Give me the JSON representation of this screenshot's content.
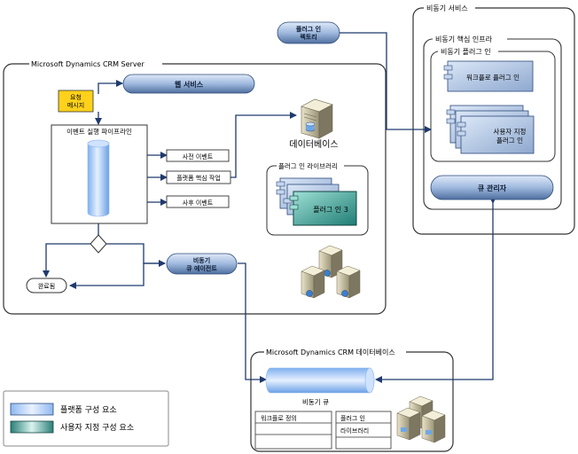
{
  "diagram": {
    "crm_server": {
      "title": "Microsoft Dynamics CRM Server"
    },
    "request_message": {
      "line1": "요청",
      "line2": "메시지"
    },
    "web_services": "웹 서비스",
    "pipeline": {
      "title": "이벤트 실행 파이프라인"
    },
    "pre_event": "사전 이벤트",
    "platform_core": "플랫폼 핵심 작업",
    "post_event": "사후 이벤트",
    "completed": "완료됨",
    "async_queue_agent": {
      "line1": "비동기",
      "line2": "큐 에이전트"
    },
    "database": "데이터베이스",
    "plugin_library": {
      "title": "플러그 인 라이브러리",
      "item": "플러그 인 3"
    },
    "async_service": {
      "title": "비동기 서비스",
      "core_infra": "비동기 핵심 인프라",
      "plugins_group": "비동기 플러그 인",
      "workflow_plugin": "워크플로 플러그 인",
      "custom_plugin": {
        "line1": "사용자 지정",
        "line2": "플러그 인"
      },
      "queue_manager": "큐 관리자"
    },
    "plugin_directory": {
      "line1": "플러그 인",
      "line2": "렉토리"
    },
    "crm_database": {
      "title": "Microsoft Dynamics CRM 데이터베이스",
      "async_queue": "비동기 큐",
      "workflow_definition": "워크플로 정의",
      "plugin_library": {
        "line1": "플러그 인",
        "line2": "라이브러리"
      }
    }
  },
  "legend": {
    "platform_component": "플랫폼 구성 요소",
    "custom_component": "사용자 지정 구성 요소"
  },
  "colors": {
    "navy": "#1f3a6e",
    "platform_blue": "#a9c9f5",
    "request_yellow": "#ffd11a",
    "custom_teal": "#2e8b82"
  }
}
